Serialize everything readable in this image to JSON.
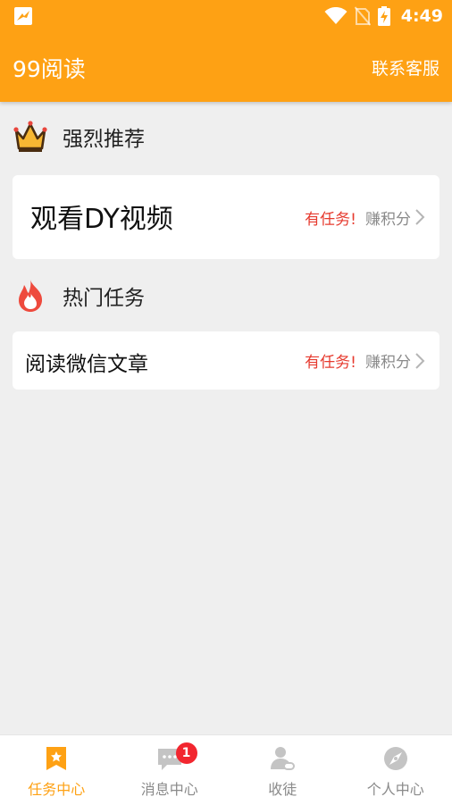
{
  "status_bar": {
    "time": "4:49"
  },
  "header": {
    "title": "99阅读",
    "contact": "联系客服"
  },
  "recommend": {
    "heading": "强烈推荐",
    "card": {
      "title": "观看DY视频",
      "tag": "有任务!",
      "action": "赚积分"
    }
  },
  "hot": {
    "heading": "热门任务",
    "card": {
      "title": "阅读微信文章",
      "tag": "有任务!",
      "action": "赚积分"
    }
  },
  "tabs": [
    {
      "label": "任务中心",
      "active": true
    },
    {
      "label": "消息中心",
      "badge": "1"
    },
    {
      "label": "收徒"
    },
    {
      "label": "个人中心"
    }
  ],
  "colors": {
    "brand": "#fea114",
    "task_red": "#e63a2e",
    "background": "#efefef",
    "badge_red": "#f2262f"
  },
  "icons": [
    "crown-icon",
    "flame-icon",
    "bookmark-star-icon",
    "chat-icon",
    "user-icon",
    "compass-icon"
  ]
}
